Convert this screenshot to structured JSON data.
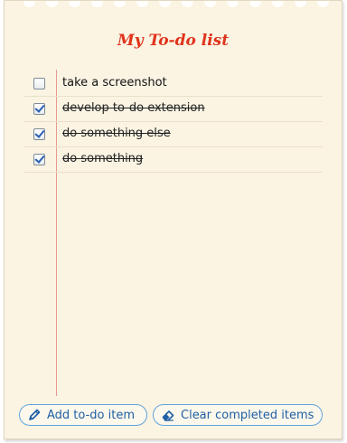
{
  "title": "My To-do list",
  "items": [
    {
      "text": "take a screenshot",
      "done": false
    },
    {
      "text": "develop to-do extension",
      "done": true
    },
    {
      "text": "do something else",
      "done": true
    },
    {
      "text": "do something",
      "done": true
    }
  ],
  "buttons": {
    "add_label": "Add to-do item",
    "add_icon": "pencil-icon",
    "clear_label": "Clear completed items",
    "clear_icon": "eraser-icon"
  },
  "colors": {
    "paper": "#fbf4e3",
    "title": "#e0331c",
    "margin_line": "#e69a92",
    "button_border": "#5fa3dc",
    "button_text": "#1f5fa4"
  }
}
